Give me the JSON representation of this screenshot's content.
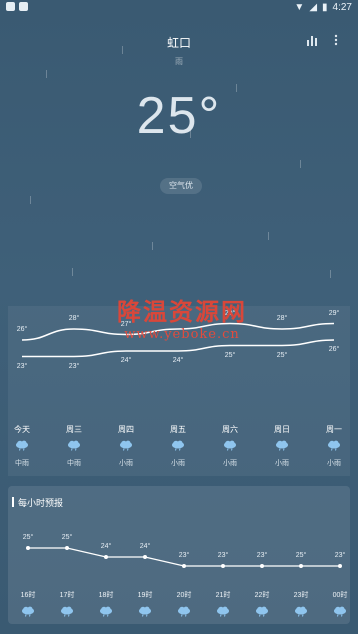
{
  "status_bar": {
    "time": "4:27"
  },
  "header": {
    "city": "虹口",
    "sub": "雨"
  },
  "current": {
    "temp": "25°",
    "aqi_label": "空气优"
  },
  "watermark": {
    "line1": "降温资源网",
    "line2": "www.yeboke.cn"
  },
  "daily": {
    "days": [
      {
        "label": "今天",
        "high": "26°",
        "low": "23°",
        "cond": "中雨"
      },
      {
        "label": "周三",
        "high": "28°",
        "low": "23°",
        "cond": "中雨"
      },
      {
        "label": "周四",
        "high": "27°",
        "low": "24°",
        "cond": "小雨"
      },
      {
        "label": "周五",
        "high": "",
        "low": "24°",
        "cond": "小雨"
      },
      {
        "label": "周六",
        "high": "29°",
        "low": "25°",
        "cond": "小雨"
      },
      {
        "label": "周日",
        "high": "28°",
        "low": "25°",
        "cond": "小雨"
      },
      {
        "label": "周一",
        "high": "29°",
        "low": "26°",
        "cond": "小雨"
      }
    ],
    "high_values": [
      26,
      28,
      27,
      null,
      29,
      28,
      29
    ],
    "low_values": [
      23,
      23,
      24,
      24,
      25,
      25,
      26
    ]
  },
  "hourly": {
    "title": "每小时预报",
    "hours": [
      {
        "time": "16时",
        "temp": "25°"
      },
      {
        "time": "17时",
        "temp": "25°"
      },
      {
        "time": "18时",
        "temp": "24°"
      },
      {
        "time": "19时",
        "temp": "24°"
      },
      {
        "time": "20时",
        "temp": "23°"
      },
      {
        "time": "21时",
        "temp": "23°"
      },
      {
        "time": "22时",
        "temp": "23°"
      },
      {
        "time": "23时",
        "temp": "25°"
      },
      {
        "time": "00时",
        "temp": "23°"
      }
    ],
    "values": [
      25,
      25,
      24,
      24,
      23,
      23,
      23,
      23,
      23
    ]
  },
  "colors": {
    "background": "#3a5a72",
    "line": "#ffffff",
    "watermark": "#d9473a",
    "cloud": "#8fc5ee"
  }
}
